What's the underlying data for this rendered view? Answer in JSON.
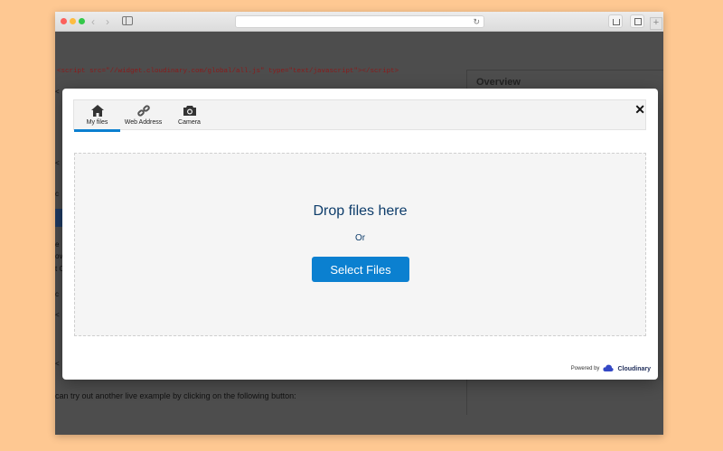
{
  "browser": {
    "back_glyph": "‹",
    "forward_glyph": "›",
    "reload_glyph": "↻",
    "newtab_glyph": "+"
  },
  "page": {
    "code_prefix": "<script src=\"//widget.cloudinary.com/global/all.js\" type=\"text/javascript\"></scr",
    "code_suffix": "ipt>",
    "overview_heading": "Overview",
    "bottom_text": "can try out another live example by clicking on the following button:",
    "fragments": [
      "<",
      "<",
      "c",
      "e",
      "ov",
      "t C",
      "c",
      "<",
      "<",
      "<"
    ]
  },
  "widget": {
    "tabs": [
      {
        "label": "My files",
        "icon": "home-icon",
        "active": true
      },
      {
        "label": "Web Address",
        "icon": "link-icon",
        "active": false
      },
      {
        "label": "Camera",
        "icon": "camera-icon",
        "active": false
      }
    ],
    "close_glyph": "✕",
    "drop_title": "Drop files here",
    "or_text": "Or",
    "select_button": "Select Files",
    "powered_by": "Powered by",
    "brand": "Cloudinary"
  },
  "colors": {
    "accent": "#0b80d0",
    "text_dark_blue": "#0e3d6b",
    "backdrop": "#fec892"
  }
}
